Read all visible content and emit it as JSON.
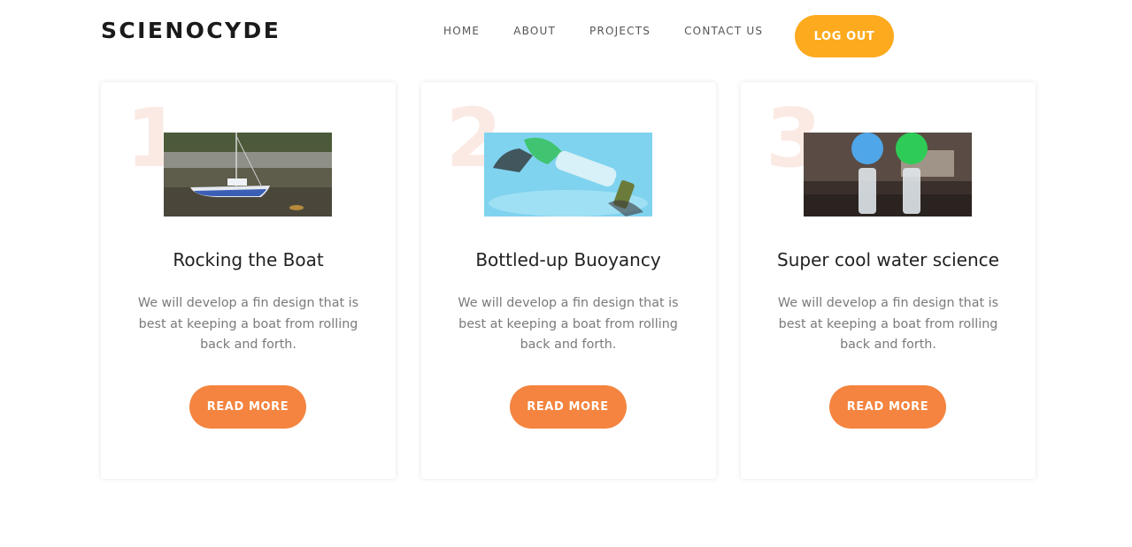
{
  "header": {
    "logo": "SCIENOCYDE",
    "nav": [
      "HOME",
      "ABOUT",
      "PROJECTS",
      "CONTACT US"
    ],
    "logout_label": "LOG OUT"
  },
  "colors": {
    "accent_yellow": "#fdaa1e",
    "accent_orange": "#f4843f",
    "number_tint": "#fbeae4"
  },
  "cards": [
    {
      "number": "1",
      "title": "Rocking the Boat",
      "description": "We will develop a fin design that is best at keeping a boat from rolling back and forth.",
      "button_label": "READ MORE"
    },
    {
      "number": "2",
      "title": "Bottled-up Buoyancy",
      "description": "We will develop a fin design that is best at keeping a boat from rolling back and forth.",
      "button_label": "READ MORE"
    },
    {
      "number": "3",
      "title": "Super cool water science",
      "description": "We will develop a fin design that is best at keeping a boat from rolling back and forth.",
      "button_label": "READ MORE"
    }
  ]
}
